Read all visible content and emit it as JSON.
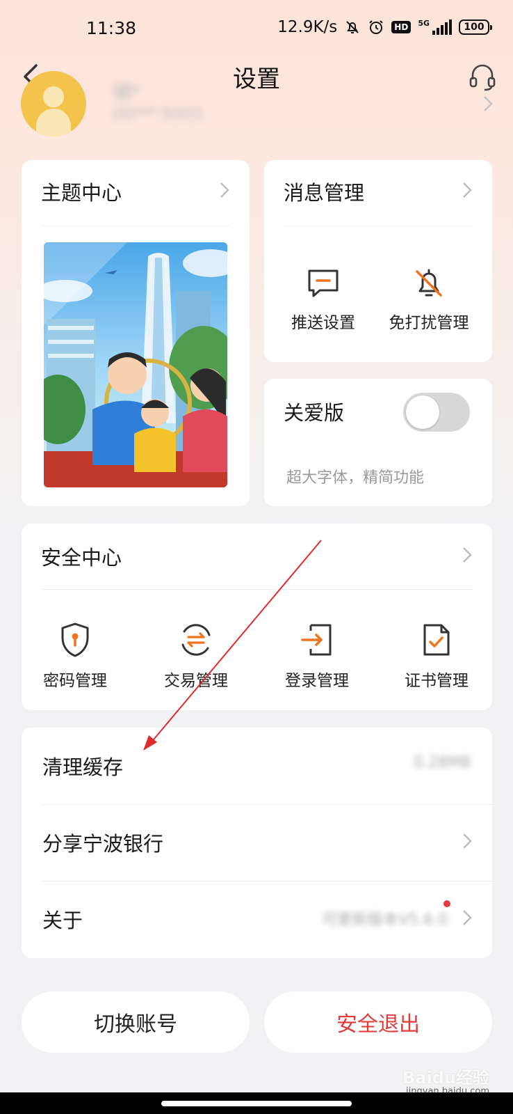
{
  "status_bar": {
    "time": "11:38",
    "speed": "12.9K/s",
    "hd": "HD",
    "network": "5G",
    "battery": "100"
  },
  "header": {
    "title": "设置"
  },
  "profile": {
    "name": "储*",
    "account": "(0)*** 5(0)1"
  },
  "theme_card": {
    "title": "主题中心"
  },
  "message_card": {
    "title": "消息管理",
    "items": [
      {
        "label": "推送设置",
        "icon": "message-icon"
      },
      {
        "label": "免打扰管理",
        "icon": "bell-off-icon"
      }
    ]
  },
  "care_card": {
    "title": "关爱版",
    "desc": "超大字体，精简功能",
    "toggle_on": false
  },
  "security_card": {
    "title": "安全中心",
    "items": [
      {
        "label": "密码管理",
        "icon": "shield-icon"
      },
      {
        "label": "交易管理",
        "icon": "exchange-icon"
      },
      {
        "label": "登录管理",
        "icon": "login-icon"
      },
      {
        "label": "证书管理",
        "icon": "certificate-icon"
      }
    ]
  },
  "list": {
    "clear_cache": {
      "label": "清理缓存",
      "value": "0.28MB"
    },
    "share": {
      "label": "分享宁波银行"
    },
    "about": {
      "label": "关于",
      "value": "可更新版本V5.6.0"
    }
  },
  "buttons": {
    "switch_account": "切换账号",
    "logout": "安全退出"
  },
  "watermark": {
    "brand": "Baidu经验",
    "site": "jingyan.baidu.com"
  },
  "colors": {
    "accent_orange": "#f0741f",
    "logout_red": "#e03a3a",
    "red_dot": "#e8383d",
    "annotation_arrow": "#e02b2b"
  }
}
